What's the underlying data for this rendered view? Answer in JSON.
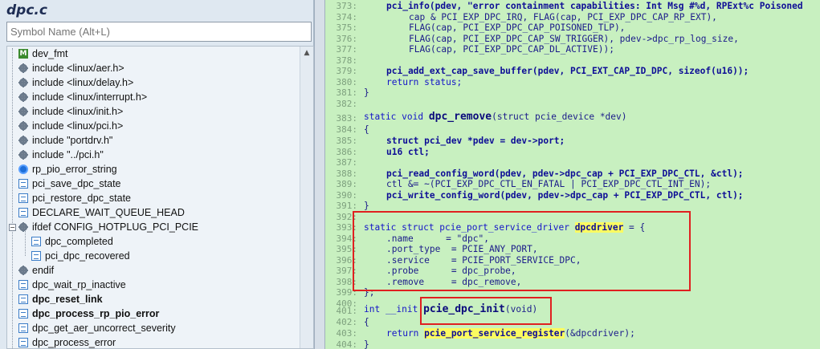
{
  "sidebar": {
    "title": "dpc.c",
    "search_placeholder": "Symbol Name (Alt+L)",
    "items": [
      {
        "label": "dev_fmt",
        "icon": "macro-icon",
        "bold": false
      },
      {
        "label": "include <linux/aer.h>",
        "icon": "include-icon",
        "bold": false
      },
      {
        "label": "include <linux/delay.h>",
        "icon": "include-icon",
        "bold": false
      },
      {
        "label": "include <linux/interrupt.h>",
        "icon": "include-icon",
        "bold": false
      },
      {
        "label": "include <linux/init.h>",
        "icon": "include-icon",
        "bold": false
      },
      {
        "label": "include <linux/pci.h>",
        "icon": "include-icon",
        "bold": false
      },
      {
        "label": "include \"portdrv.h\"",
        "icon": "include-icon",
        "bold": false
      },
      {
        "label": "include \"../pci.h\"",
        "icon": "include-icon",
        "bold": false
      },
      {
        "label": "rp_pio_error_string",
        "icon": "variable-icon",
        "bold": false
      },
      {
        "label": "pci_save_dpc_state",
        "icon": "function-icon",
        "bold": false
      },
      {
        "label": "pci_restore_dpc_state",
        "icon": "function-icon",
        "bold": false
      },
      {
        "label": "DECLARE_WAIT_QUEUE_HEAD",
        "icon": "function-icon",
        "bold": false
      },
      {
        "label": "ifdef CONFIG_HOTPLUG_PCI_PCIE",
        "icon": "ifdef-icon",
        "bold": false
      },
      {
        "label": "dpc_completed",
        "icon": "function-icon",
        "bold": false
      },
      {
        "label": "pci_dpc_recovered",
        "icon": "function-icon",
        "bold": false
      },
      {
        "label": "endif",
        "icon": "include-icon",
        "bold": false
      },
      {
        "label": "dpc_wait_rp_inactive",
        "icon": "function-icon",
        "bold": false
      },
      {
        "label": "dpc_reset_link",
        "icon": "function-icon",
        "bold": true
      },
      {
        "label": "dpc_process_rp_pio_error",
        "icon": "function-icon",
        "bold": true
      },
      {
        "label": "dpc_get_aer_uncorrect_severity",
        "icon": "function-icon",
        "bold": false
      },
      {
        "label": "dpc_process_error",
        "icon": "function-icon",
        "bold": false
      }
    ]
  },
  "editor": {
    "line_numbers": [
      "373:",
      "374:",
      "375:",
      "376:",
      "377:",
      "378:",
      "379:",
      "380:",
      "381:",
      "382:",
      "383:",
      "384:",
      "385:",
      "386:",
      "387:",
      "388:",
      "389:",
      "390:",
      "391:",
      "392:",
      "393:",
      "394:",
      "395:",
      "396:",
      "397:",
      "398:",
      "399:",
      "400:",
      "401:",
      "402:",
      "403:",
      "404:"
    ],
    "lines": {
      "l373": "pci_info(pdev, \"error containment capabilities: Int Msg #%d, RPExt%c Poisoned",
      "l374": "cap & PCI_EXP_DPC_IRQ, FLAG(cap, PCI_EXP_DPC_CAP_RP_EXT),",
      "l375": "FLAG(cap, PCI_EXP_DPC_CAP_POISONED_TLP),",
      "l376": "FLAG(cap, PCI_EXP_DPC_CAP_SW_TRIGGER), pdev->dpc_rp_log_size,",
      "l377": "FLAG(cap, PCI_EXP_DPC_CAP_DL_ACTIVE));",
      "l379": "pci_add_ext_cap_save_buffer(pdev, PCI_EXT_CAP_ID_DPC, sizeof(u16));",
      "l380": "return status;",
      "l381": "}",
      "l383a": "static void ",
      "l383b": "dpc_remove",
      "l383c": "(struct pcie_device *dev)",
      "l384": "{",
      "l385": "struct pci_dev *pdev = dev->port;",
      "l386": "u16 ctl;",
      "l388": "pci_read_config_word(pdev, pdev->dpc_cap + PCI_EXP_DPC_CTL, &ctl);",
      "l389": "ctl &= ~(PCI_EXP_DPC_CTL_EN_FATAL | PCI_EXP_DPC_CTL_INT_EN);",
      "l390": "pci_write_config_word(pdev, pdev->dpc_cap + PCI_EXP_DPC_CTL, ctl);",
      "l391": "}",
      "l393a": "static struct pcie_port_service_driver ",
      "l393b": "dpcdriver",
      "l393c": " = {",
      "l394": ".name      = \"dpc\",",
      "l395": ".port_type  = PCIE_ANY_PORT,",
      "l396": ".service    = PCIE_PORT_SERVICE_DPC,",
      "l397": ".probe      = dpc_probe,",
      "l398": ".remove     = dpc_remove,",
      "l399": "};",
      "l401a": "int __init ",
      "l401b": "pcie_dpc_init",
      "l401c": "(void)",
      "l402": "{",
      "l403a": "return ",
      "l403b": "pcie_port_service_register",
      "l403c": "(&dpcdriver);",
      "l404": "}"
    }
  },
  "colors": {
    "editor_bg": "#c8f0c0",
    "sidebar_bg": "#dfe8f1",
    "highlight_box": "#e02020"
  }
}
